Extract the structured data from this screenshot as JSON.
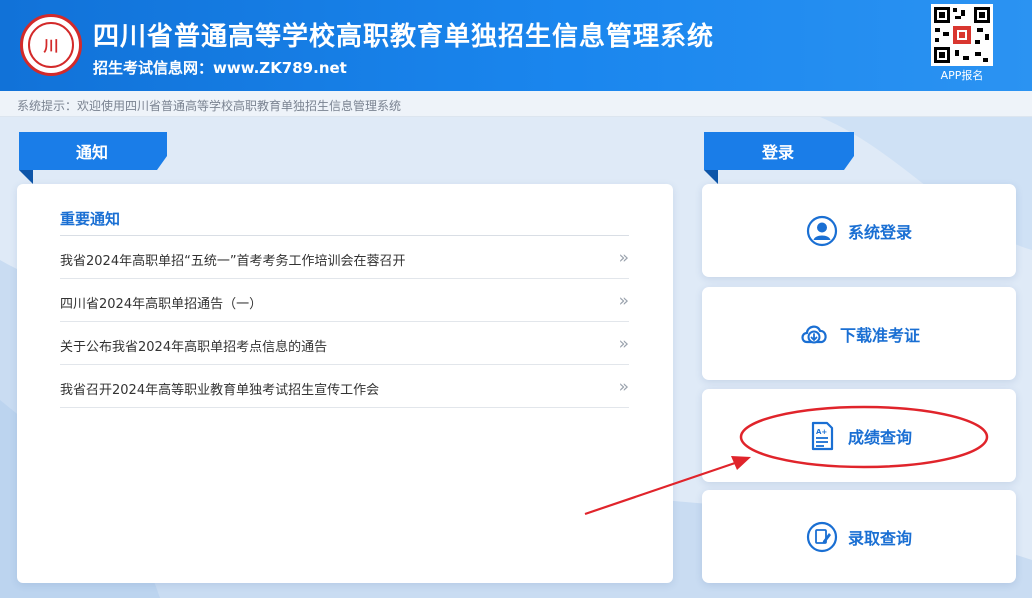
{
  "header": {
    "title": "四川省普通高等学校高职教育单独招生信息管理系统",
    "subtitle": "招生考试信息网：www.ZK789.net",
    "qr_label": "APP报名",
    "logo_text": "川"
  },
  "notice_bar": {
    "text": "系统提示：欢迎使用四川省普通高等学校高职教育单独招生信息管理系统"
  },
  "notice_section": {
    "tab_label": "通知",
    "panel_title": "重要通知",
    "items": [
      {
        "text": "我省2024年高职单招“五统一”首考考务工作培训会在蓉召开"
      },
      {
        "text": "四川省2024年高职单招通告（一）"
      },
      {
        "text": "关于公布我省2024年高职单招考点信息的通告"
      },
      {
        "text": "我省召开2024年高等职业教育单独考试招生宣传工作会"
      }
    ],
    "arrow_glyph": "»"
  },
  "login_section": {
    "tab_label": "登录",
    "cards": [
      {
        "label": "系统登录",
        "icon": "user-icon"
      },
      {
        "label": "下载准考证",
        "icon": "cloud-download-icon"
      },
      {
        "label": "成绩查询",
        "icon": "grade-document-icon"
      },
      {
        "label": "录取查询",
        "icon": "edit-icon"
      }
    ]
  },
  "colors": {
    "header_blue": "#1a86ee",
    "accent_blue": "#1a6fd3",
    "annotation_red": "#e0242b"
  }
}
